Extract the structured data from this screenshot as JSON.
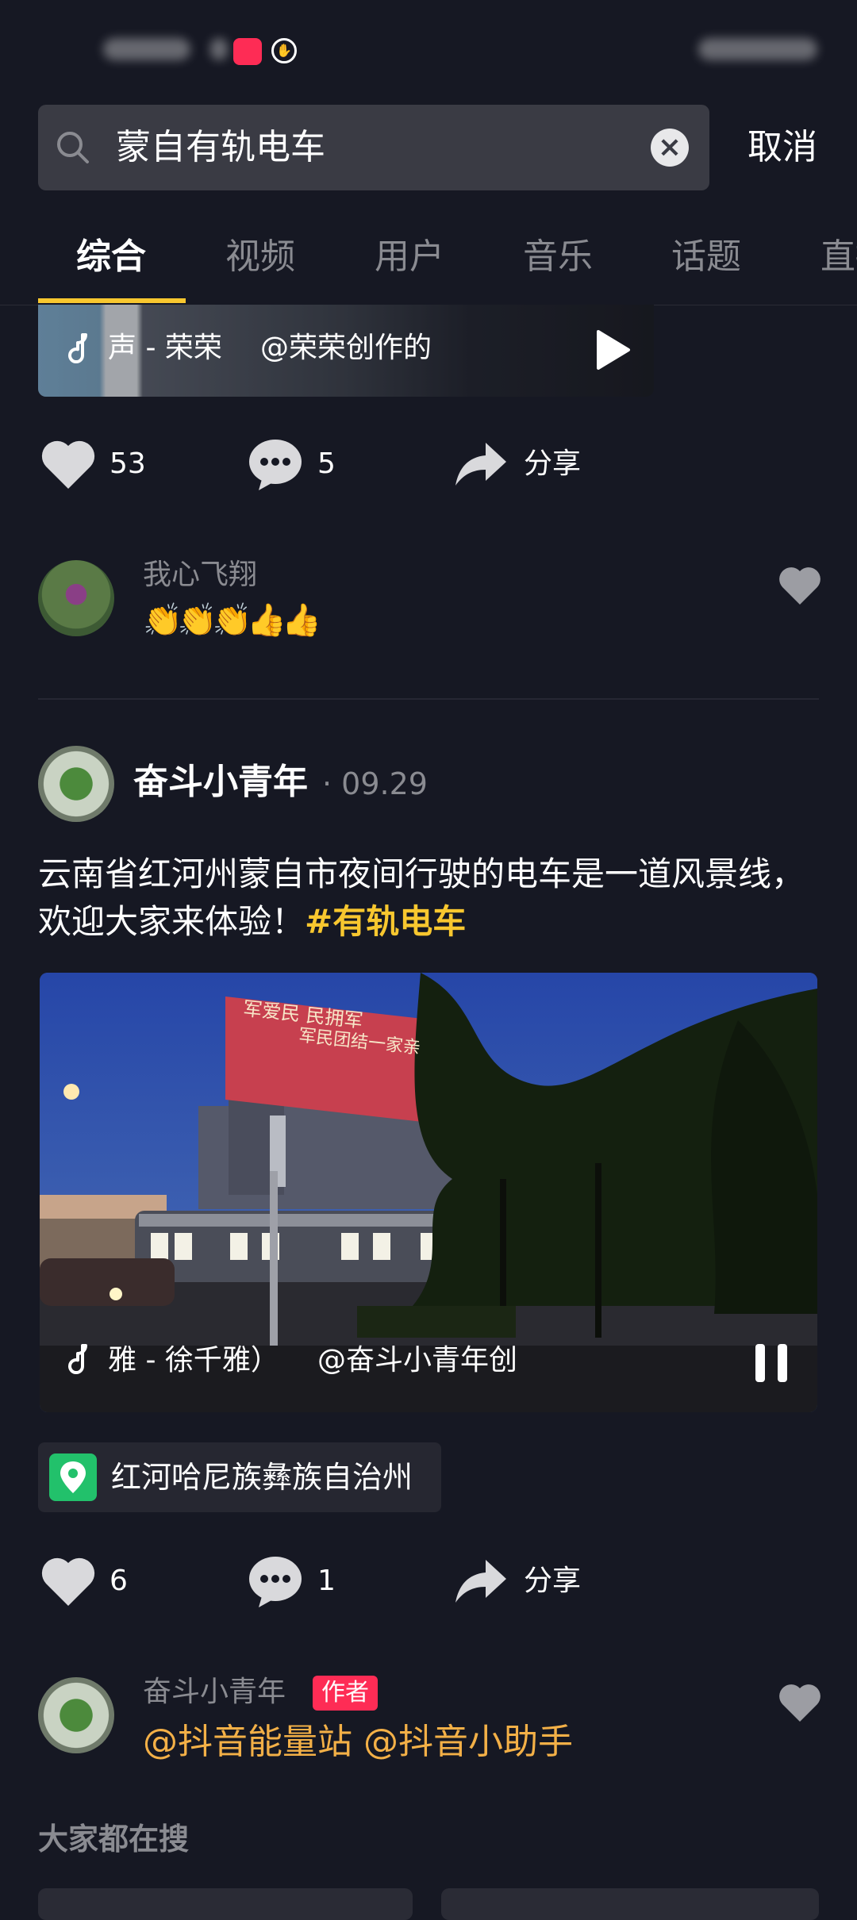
{
  "search": {
    "query": "蒙自有轨电车",
    "cancel_label": "取消"
  },
  "tabs": [
    {
      "label": "综合",
      "active": true
    },
    {
      "label": "视频"
    },
    {
      "label": "用户"
    },
    {
      "label": "音乐"
    },
    {
      "label": "话题"
    },
    {
      "label": "直播"
    }
  ],
  "top_card": {
    "music_text": "声 - 荣荣",
    "author_text": "@荣荣创作的"
  },
  "post1_actions": {
    "likes": "53",
    "comments": "5",
    "share_label": "分享"
  },
  "comment1": {
    "user": "我心飞翔",
    "emoji": "👏👏👏👍👍"
  },
  "post": {
    "user": "奋斗小青年",
    "date": "· 09.29",
    "text": "云南省红河州蒙自市夜间行驶的电车是一道风景线，欢迎大家来体验！",
    "hashtag": "#有轨电车",
    "video_music": "雅 - 徐千雅）",
    "video_author": "@奋斗小青年创",
    "video_sign_line1": "军爱民  民拥军",
    "video_sign_line2": "军民团结一家亲",
    "location": "红河哈尼族彝族自治州"
  },
  "post2_actions": {
    "likes": "6",
    "comments": "1",
    "share_label": "分享"
  },
  "comment2": {
    "user": "奋斗小青年",
    "badge": "作者",
    "text": "@抖音能量站 @抖音小助手"
  },
  "section": {
    "title": "大家都在搜"
  },
  "colors": {
    "background": "#161823",
    "accent_yellow": "#f8c72f",
    "brand_red": "#fe2c55",
    "location_green": "#22c16b",
    "mention_orange": "#f3b047"
  }
}
